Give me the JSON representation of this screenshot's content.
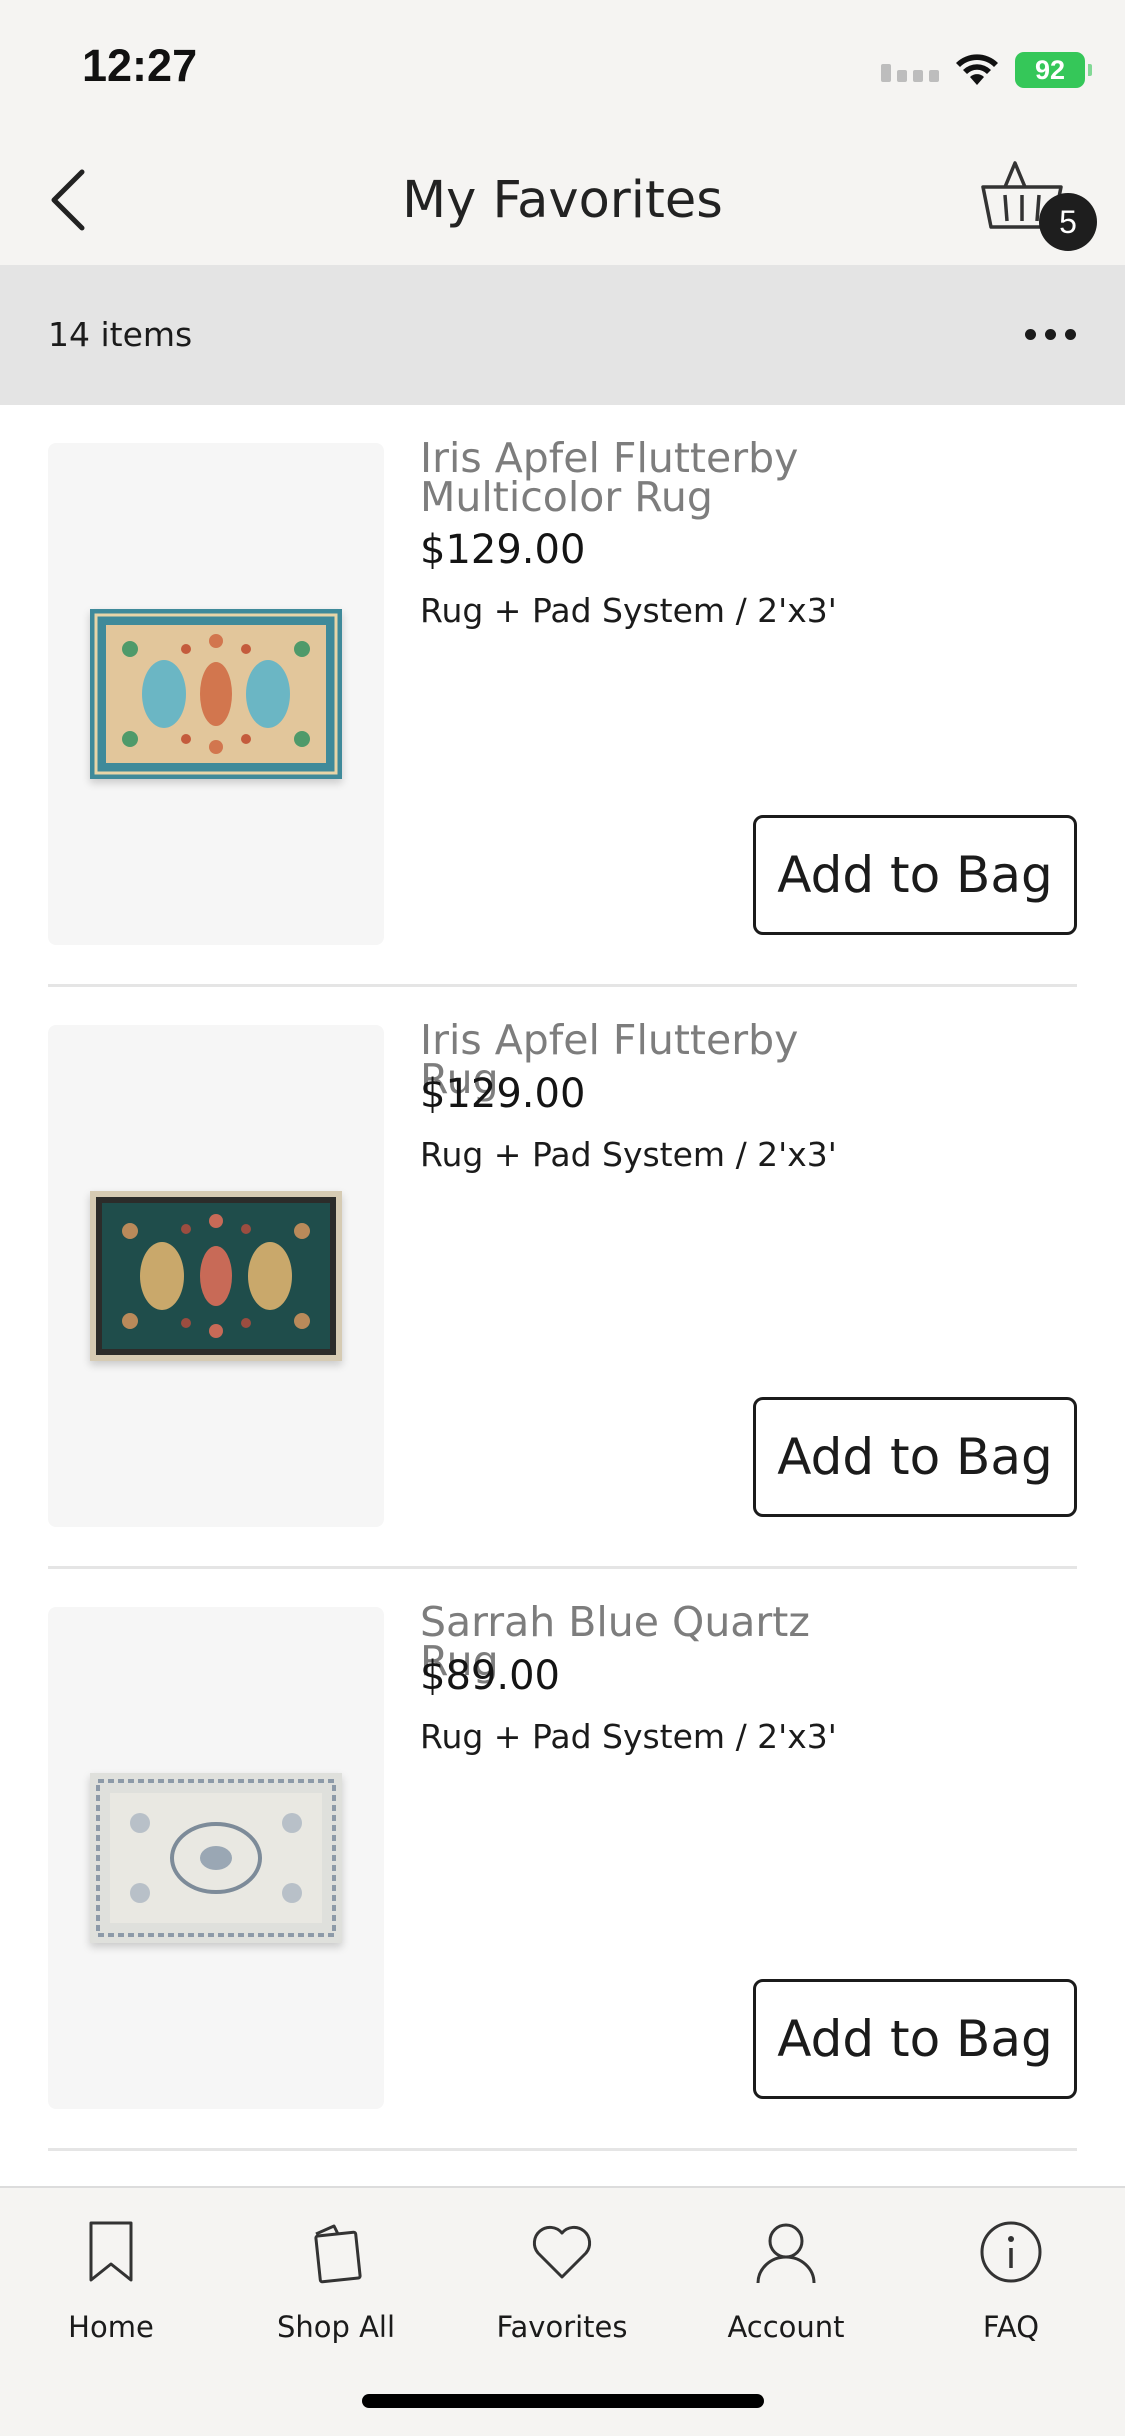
{
  "status_bar": {
    "time": "12:27",
    "battery": "92"
  },
  "header": {
    "title": "My Favorites",
    "cart_count": "5"
  },
  "list_bar": {
    "count": "14 items"
  },
  "products": [
    {
      "name": "Iris Apfel Flutterby Multicolor Rug",
      "price": "$129.00",
      "variant": "Rug + Pad System / 2'x3'",
      "button": "Add to Bag"
    },
    {
      "name": "Iris Apfel Flutterby Rug",
      "price": "$129.00",
      "variant": "Rug + Pad System / 2'x3'",
      "button": "Add to Bag"
    },
    {
      "name": "Sarrah Blue Quartz Rug",
      "price": "$89.00",
      "variant": "Rug + Pad System / 2'x3'",
      "button": "Add to Bag"
    }
  ],
  "tabs": [
    {
      "label": "Home",
      "icon": "bookmark-icon"
    },
    {
      "label": "Shop All",
      "icon": "shopping-bag-icon"
    },
    {
      "label": "Favorites",
      "icon": "heart-icon"
    },
    {
      "label": "Account",
      "icon": "user-icon"
    },
    {
      "label": "FAQ",
      "icon": "info-icon"
    }
  ],
  "colors": {
    "header_bg": "#f5f4f2",
    "count_bar_bg": "#e4e4e4",
    "battery_green": "#35c759",
    "product_name_gray": "#7d7d7d"
  }
}
